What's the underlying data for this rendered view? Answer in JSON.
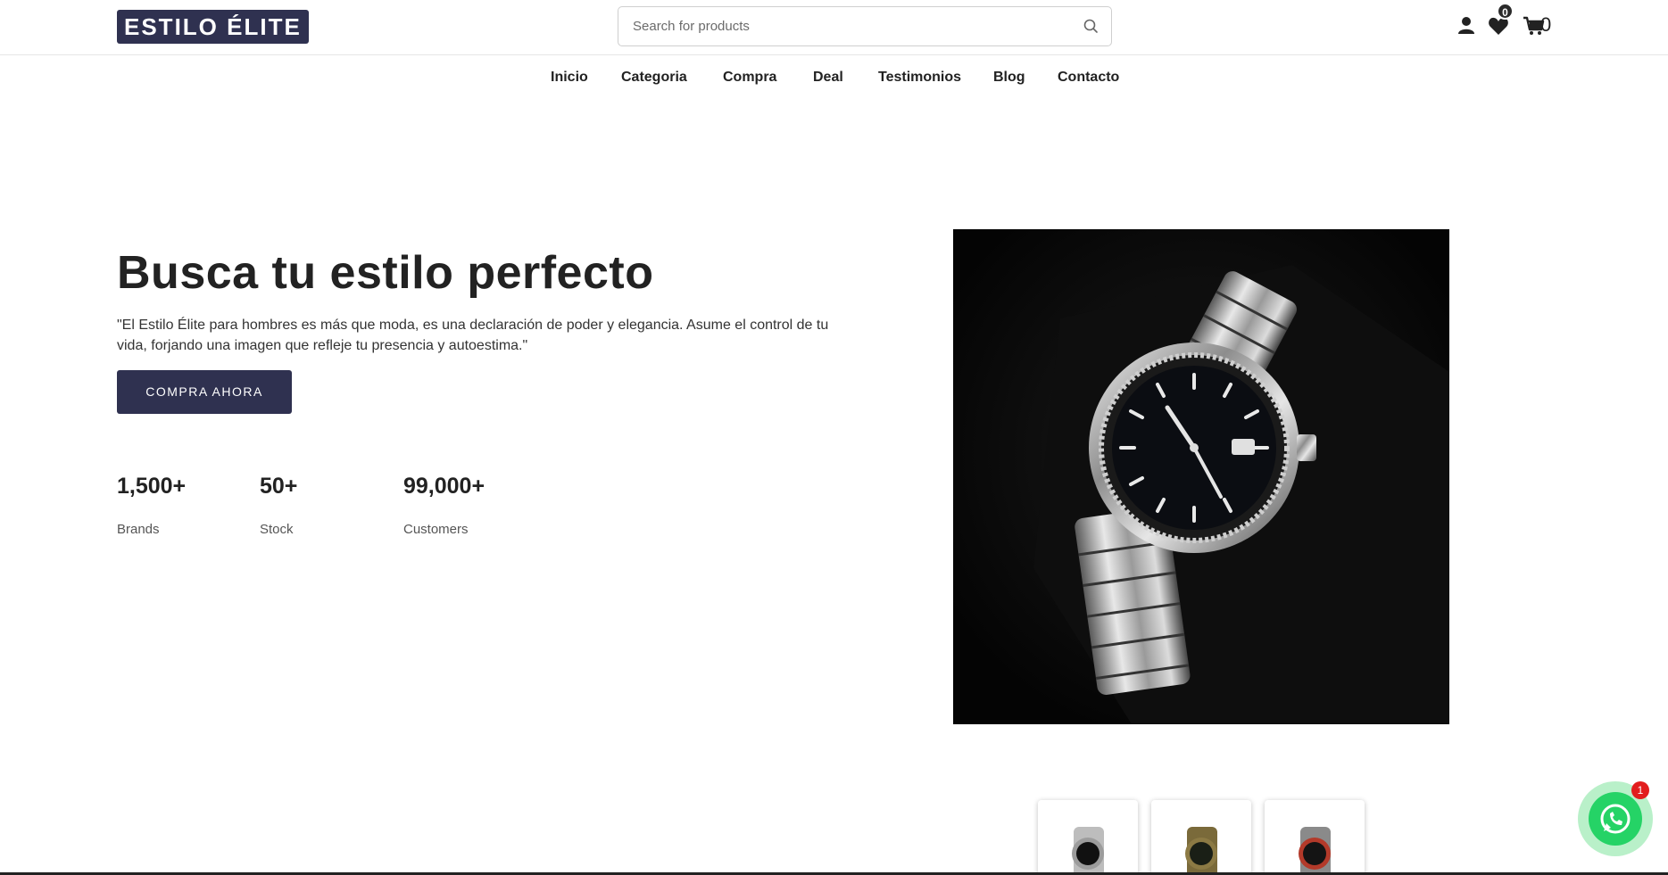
{
  "header": {
    "logo": "ESTILO ÉLITE",
    "search_placeholder": "Search for products",
    "wishlist_count": "0",
    "cart_count": "0"
  },
  "nav": {
    "items": [
      "Inicio",
      "Categoria",
      "Compra",
      "Deal",
      "Testimonios",
      "Blog",
      "Contacto"
    ]
  },
  "hero": {
    "title": "Busca tu estilo perfecto",
    "quote": "\"El Estilo Élite para hombres es más que moda, es una declaración de poder y elegancia. Asume el control de tu vida, forjando una imagen que refleje tu presencia y autoestima.\"",
    "cta_label": "COMPRA AHORA",
    "stats": [
      {
        "value": "1,500+",
        "label": "Brands"
      },
      {
        "value": "50+",
        "label": "Stock"
      },
      {
        "value": "99,000+",
        "label": "Customers"
      }
    ]
  },
  "whatsapp": {
    "badge": "1"
  },
  "colors": {
    "brand": "#2f3150",
    "whatsapp": "#25d366",
    "badge_red": "#e21d1d"
  }
}
